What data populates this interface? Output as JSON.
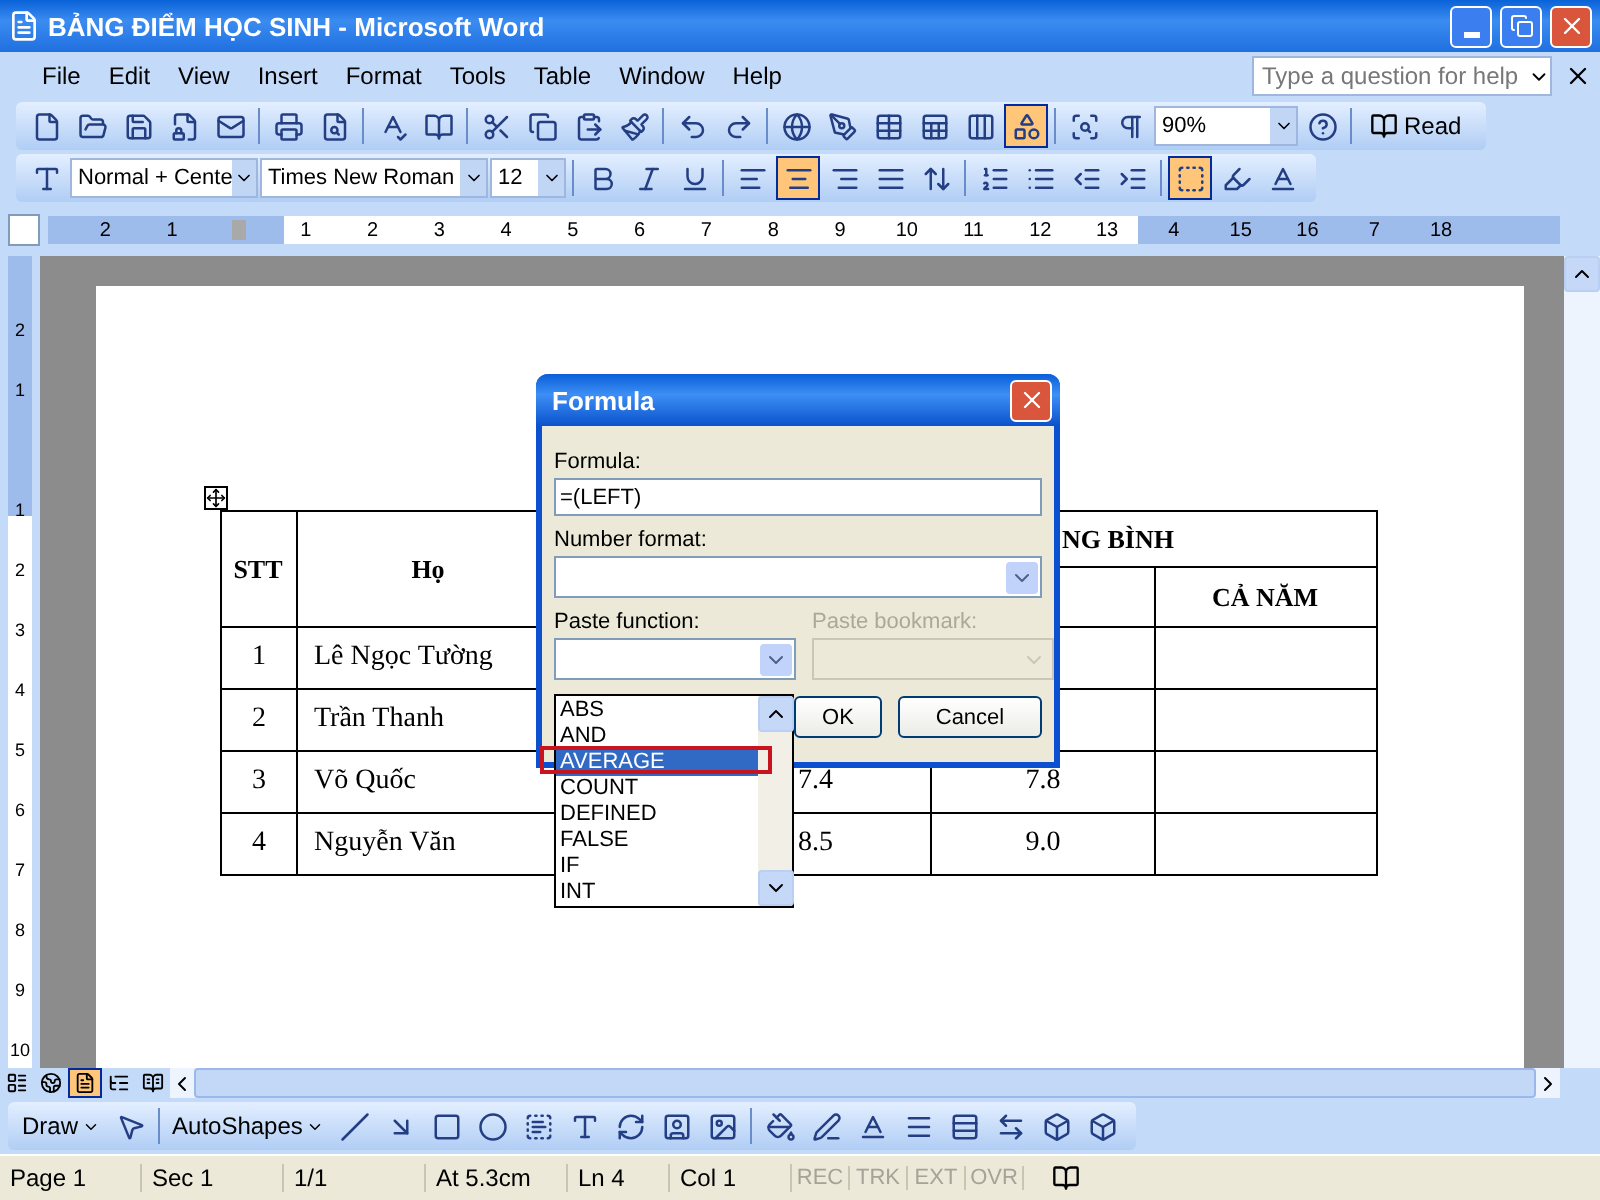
{
  "window": {
    "title": "BẢNG ĐIỂM HỌC SINH - Microsoft Word"
  },
  "menu": [
    "File",
    "Edit",
    "View",
    "Insert",
    "Format",
    "Tools",
    "Table",
    "Window",
    "Help"
  ],
  "help_box": {
    "placeholder": "Type a question for help"
  },
  "standard_toolbar": {
    "zoom": "90%",
    "read_button": "Read",
    "drawing_toggle": {
      "on": true
    }
  },
  "formatting_toolbar": {
    "style": "Normal + Cente",
    "font": "Times New Roman",
    "size": "12",
    "alignment": [
      {
        "kind": "left",
        "selected": false
      },
      {
        "kind": "center",
        "selected": true
      },
      {
        "kind": "right",
        "selected": false
      },
      {
        "kind": "justify",
        "selected": false
      }
    ],
    "borders": {
      "on": true
    }
  },
  "ruler": {
    "before_zero": [
      "2",
      "1"
    ],
    "after_zero": [
      "1",
      "2",
      "3",
      "4",
      "5",
      "6",
      "7",
      "8",
      "9",
      "10",
      "11",
      "12",
      "13",
      "4",
      "15",
      "16",
      "7",
      "18"
    ]
  },
  "vertical_ruler": {
    "before_zero": [
      "2",
      "1"
    ],
    "after_zero": [
      "1",
      "2",
      "3",
      "4",
      "5",
      "6",
      "7",
      "8",
      "9",
      "10"
    ]
  },
  "table": {
    "header": {
      "stt": "STT",
      "name": "Họ",
      "group": "NG BÌNH",
      "year": "CẢ NĂM"
    },
    "rows": [
      {
        "stt": "1",
        "name": "Lê Ngọc Tường"
      },
      {
        "stt": "2",
        "name": "Trần Thanh"
      },
      {
        "stt": "3",
        "name": "Võ Quốc",
        "column_4": "7.4",
        "column_5": "7.8"
      },
      {
        "stt": "4",
        "name": "Nguyễn Văn",
        "column_4": "8.5",
        "column_5": "9.0"
      }
    ]
  },
  "dialog": {
    "title": "Formula",
    "formula_label": "Formula:",
    "formula_value": "=(LEFT)",
    "number_format_label": "Number format:",
    "paste_function_label": "Paste function:",
    "paste_bookmark": {
      "label": "Paste bookmark:",
      "disabled": true
    },
    "functions": [
      {
        "label": "ABS",
        "selected": false
      },
      {
        "label": "AND",
        "selected": false
      },
      {
        "label": "AVERAGE",
        "selected": true
      },
      {
        "label": "COUNT",
        "selected": false
      },
      {
        "label": "DEFINED",
        "selected": false
      },
      {
        "label": "FALSE",
        "selected": false
      },
      {
        "label": "IF",
        "selected": false
      },
      {
        "label": "INT",
        "selected": false
      }
    ],
    "ok": "OK",
    "cancel": "Cancel"
  },
  "view_buttons": [
    {
      "kind": "normal",
      "selected": false
    },
    {
      "kind": "web",
      "selected": false
    },
    {
      "kind": "print",
      "selected": true
    },
    {
      "kind": "outline",
      "selected": false
    },
    {
      "kind": "reading",
      "selected": false
    }
  ],
  "drawing_toolbar": {
    "draw": "Draw",
    "autoshapes": "AutoShapes"
  },
  "status_bar": {
    "page": "Page 1",
    "section": "Sec 1",
    "pages": "1/1",
    "at": "At 5.3cm",
    "line": "Ln 4",
    "column": "Col 1",
    "modes": [
      {
        "label": "REC",
        "on": false
      },
      {
        "label": "TRK",
        "on": false
      },
      {
        "label": "EXT",
        "on": false
      },
      {
        "label": "OVR",
        "on": false
      }
    ]
  }
}
